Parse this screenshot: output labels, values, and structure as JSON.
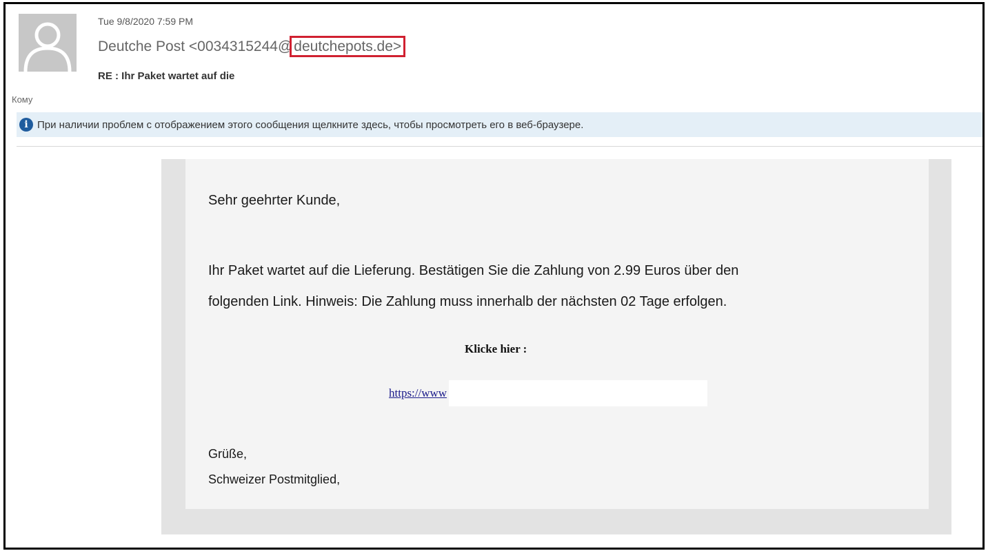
{
  "header": {
    "date": "Tue 9/8/2020 7:59 PM",
    "sender_name_prefix": "Deutche Post <0034315244@",
    "sender_domain": "deutchepots.de>",
    "subject": "RE : Ihr Paket wartet auf die",
    "to_label": "Кому",
    "avatar_icon": "person-icon"
  },
  "info_bar": {
    "icon": "info-icon",
    "icon_glyph": "i",
    "text": "При наличии проблем с отображением этого сообщения щелкните здесь, чтобы просмотреть его в веб-браузере."
  },
  "body": {
    "greeting": "Sehr geehrter Kunde,",
    "paragraph_line1": "Ihr Paket wartet auf die Lieferung. Bestätigen Sie die Zahlung von 2.99 Euros über den",
    "paragraph_line2": "folgenden Link. Hinweis: Die Zahlung muss innerhalb der nächsten 02 Tage erfolgen.",
    "cta_label": "Klicke hier :",
    "link_text": "https://www",
    "regards": "Grüße,",
    "signature": "Schweizer Postmitglied,"
  },
  "colors": {
    "highlight_border": "#d02030",
    "info_bar_bg": "#e4eff7",
    "info_icon": "#1f5c9e",
    "link": "#1a1a8a"
  }
}
